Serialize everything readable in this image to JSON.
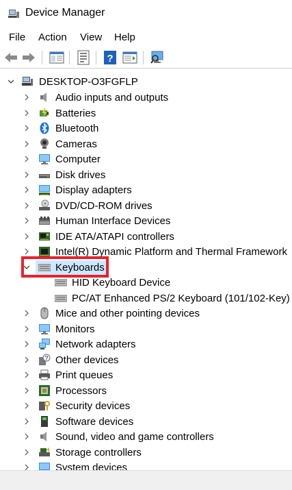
{
  "window": {
    "title": "Device Manager"
  },
  "menu": [
    {
      "label": "File"
    },
    {
      "label": "Action"
    },
    {
      "label": "View"
    },
    {
      "label": "Help"
    }
  ],
  "toolbar": {
    "buttons": [
      "back-icon",
      "forward-icon",
      "show-hide-console-tree-icon",
      "properties-icon",
      "help-icon",
      "action-pane-icon",
      "scan-hardware-icon"
    ]
  },
  "tree": {
    "root": "DESKTOP-O3FGFLP",
    "categories": [
      {
        "label": "Audio inputs and outputs",
        "icon": "speaker-icon",
        "expanded": false
      },
      {
        "label": "Batteries",
        "icon": "battery-icon",
        "expanded": false
      },
      {
        "label": "Bluetooth",
        "icon": "bluetooth-icon",
        "expanded": false
      },
      {
        "label": "Cameras",
        "icon": "camera-icon",
        "expanded": false
      },
      {
        "label": "Computer",
        "icon": "computer-icon",
        "expanded": false
      },
      {
        "label": "Disk drives",
        "icon": "disk-drive-icon",
        "expanded": false
      },
      {
        "label": "Display adapters",
        "icon": "display-adapter-icon",
        "expanded": false
      },
      {
        "label": "DVD/CD-ROM drives",
        "icon": "dvd-icon",
        "expanded": false
      },
      {
        "label": "Human Interface Devices",
        "icon": "hid-icon",
        "expanded": false
      },
      {
        "label": "IDE ATA/ATAPI controllers",
        "icon": "ide-icon",
        "expanded": false
      },
      {
        "label": "Intel(R) Dynamic Platform and Thermal Framework",
        "icon": "chip-icon",
        "expanded": false
      },
      {
        "label": "Keyboards",
        "icon": "keyboard-icon",
        "expanded": true,
        "selected": true,
        "children": [
          {
            "label": "HID Keyboard Device",
            "icon": "keyboard-icon"
          },
          {
            "label": "PC/AT Enhanced PS/2 Keyboard (101/102-Key)",
            "icon": "keyboard-icon"
          }
        ]
      },
      {
        "label": "Mice and other pointing devices",
        "icon": "mouse-icon",
        "expanded": false
      },
      {
        "label": "Monitors",
        "icon": "monitor-icon",
        "expanded": false
      },
      {
        "label": "Network adapters",
        "icon": "network-icon",
        "expanded": false
      },
      {
        "label": "Other devices",
        "icon": "other-devices-icon",
        "expanded": false
      },
      {
        "label": "Print queues",
        "icon": "printer-icon",
        "expanded": false
      },
      {
        "label": "Processors",
        "icon": "processor-icon",
        "expanded": false
      },
      {
        "label": "Security devices",
        "icon": "security-icon",
        "expanded": false
      },
      {
        "label": "Software devices",
        "icon": "software-icon",
        "expanded": false
      },
      {
        "label": "Sound, video and game controllers",
        "icon": "sound-icon",
        "expanded": false
      },
      {
        "label": "Storage controllers",
        "icon": "storage-icon",
        "expanded": false
      },
      {
        "label": "System devices",
        "icon": "system-icon",
        "expanded": false
      }
    ]
  },
  "colors": {
    "selection": "#cce8ff",
    "highlight_border": "#e8222c",
    "accent_blue": "#1a73d6"
  }
}
